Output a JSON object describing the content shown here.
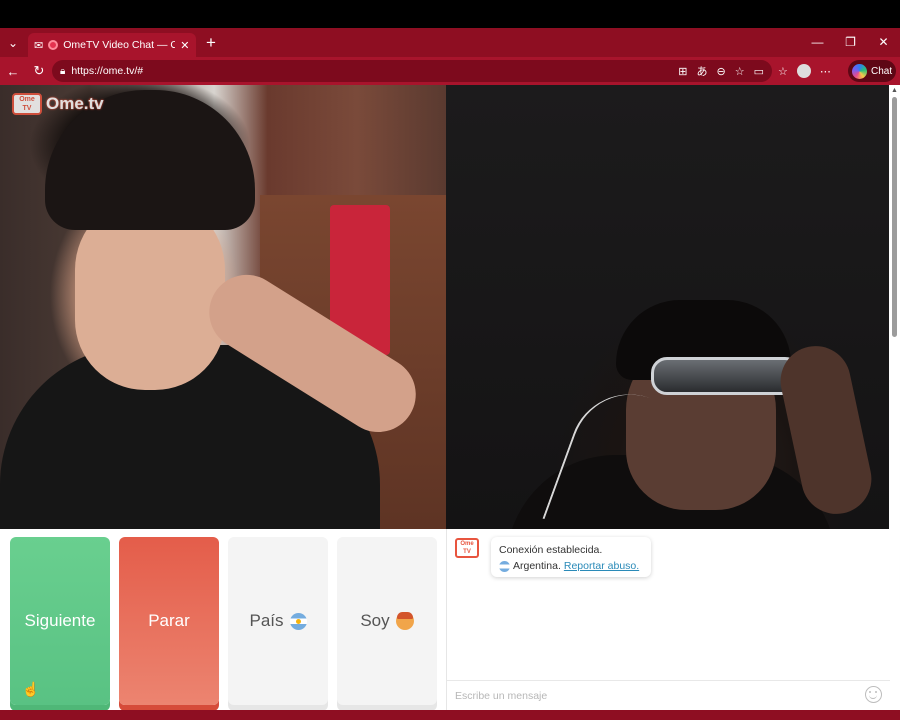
{
  "browser": {
    "tab_title": "OmeTV Video Chat — Omegle",
    "url": "https://ome.tv/#",
    "copilot_label": "Chat"
  },
  "logo": {
    "text": "Ome.tv",
    "badge": "Ome TV"
  },
  "controls": {
    "next_label": "Siguiente",
    "stop_label": "Parar",
    "country_label": "País",
    "me_label": "Soy"
  },
  "chat": {
    "status_message": "Conexión establecida.",
    "country": "Argentina.",
    "report_link": "Reportar abuso.",
    "input_placeholder": "Escribe un mensaje",
    "avatar_badge": "Ome TV"
  },
  "colors": {
    "browser_frame": "#8e0e22",
    "next_button": "#59c283",
    "stop_button": "#e45d4a"
  }
}
